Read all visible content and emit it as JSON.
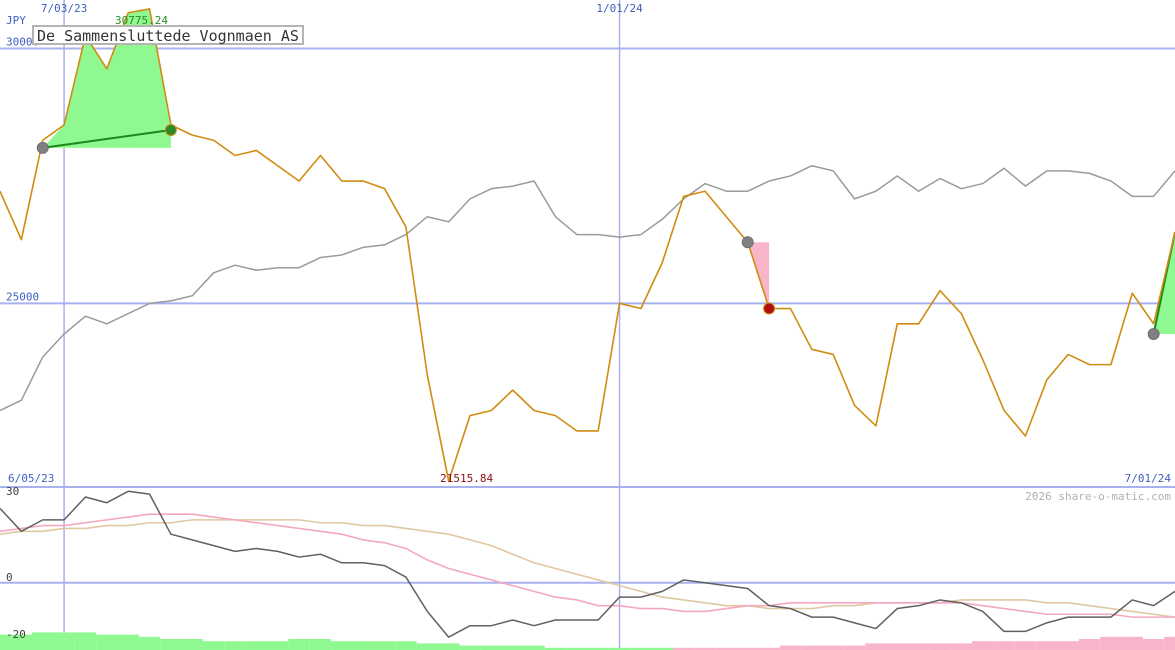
{
  "title": "De Sammensluttede Vognmaen AS",
  "watermark": "2026 share-o-matic.com",
  "colors": {
    "price": "#d08c10",
    "avg": "#9a9a9a",
    "grid": "#a8b2ee",
    "axis_text": "#4060c0",
    "gain_fill": "#90f890",
    "gain_line": "#1a8a1a",
    "loss_fill": "#f8b4c8",
    "loss_dot": "#b01010",
    "osc_dark": "#606060",
    "osc_pink": "#f4a8c0",
    "osc_tan": "#e0c8a0",
    "vol_green": "#90f890",
    "vol_pink": "#f8b4c8"
  },
  "chart_data": [
    {
      "type": "line",
      "currency_label": "JPY",
      "date_labels": [
        {
          "label": "7/03/23",
          "index": 3
        },
        {
          "label": "1/01/24",
          "index": 29
        }
      ],
      "range_labels": {
        "start": "6/05/23",
        "end": "7/01/24"
      },
      "max_label": "30775.24",
      "min_label": "21515.84",
      "ylim": [
        21400,
        30950
      ],
      "yticks": [
        25000,
        30000
      ],
      "series": [
        {
          "key": "price",
          "values": [
            27200,
            26250,
            28200,
            28500,
            30250,
            29600,
            30700,
            30775,
            28500,
            28300,
            28200,
            27900,
            28000,
            27700,
            27400,
            27900,
            27400,
            27400,
            27250,
            26500,
            23600,
            21516,
            22800,
            22900,
            23300,
            22900,
            22800,
            22500,
            22500,
            25000,
            24900,
            25800,
            27100,
            27200,
            26700,
            26200,
            24900,
            24900,
            24100,
            24000,
            23000,
            22600,
            24600,
            24600,
            25250,
            24800,
            23900,
            22900,
            22400,
            23500,
            24000,
            23800,
            23800,
            25200,
            24600,
            26400
          ]
        },
        {
          "key": "avg",
          "values": [
            22900,
            23100,
            23950,
            24400,
            24750,
            24600,
            24800,
            25000,
            25050,
            25150,
            25600,
            25750,
            25650,
            25700,
            25700,
            25900,
            25950,
            26100,
            26150,
            26350,
            26700,
            26600,
            27050,
            27250,
            27300,
            27400,
            26700,
            26350,
            26350,
            26300,
            26350,
            26650,
            27050,
            27350,
            27200,
            27200,
            27400,
            27500,
            27700,
            27600,
            27050,
            27200,
            27500,
            27200,
            27450,
            27250,
            27350,
            27650,
            27300,
            27600,
            27600,
            27550,
            27400,
            27100,
            27100,
            27600
          ]
        }
      ],
      "annotations": [
        {
          "kind": "gain",
          "from_index": 2,
          "to_index": 8,
          "from_value": 28050,
          "to_value": 28400
        },
        {
          "kind": "loss",
          "from_index": 35,
          "to_index": 36,
          "from_value": 26200,
          "to_value": 24900
        },
        {
          "kind": "gain",
          "from_index": 54,
          "to_index": 55,
          "from_value": 24400,
          "to_value": 26400
        }
      ]
    },
    {
      "type": "line",
      "ylim": [
        -20,
        30
      ],
      "yticks": [
        30,
        0,
        -20
      ],
      "series": [
        {
          "key": "osc_dark",
          "values": [
            26,
            18,
            22,
            22,
            30,
            28,
            32,
            31,
            17,
            15,
            13,
            11,
            12,
            11,
            9,
            10,
            7,
            7,
            6,
            2,
            -10,
            -19,
            -15,
            -15,
            -13,
            -15,
            -13,
            -13,
            -13,
            -5,
            -5,
            -3,
            1,
            0,
            -1,
            -2,
            -8,
            -9,
            -12,
            -12,
            -14,
            -16,
            -9,
            -8,
            -6,
            -7,
            -10,
            -17,
            -17,
            -14,
            -12,
            -12,
            -12,
            -6,
            -8,
            -3
          ]
        },
        {
          "key": "osc_pink",
          "values": [
            18,
            19,
            20,
            20,
            21,
            22,
            23,
            24,
            24,
            24,
            23,
            22,
            21,
            20,
            19,
            18,
            17,
            15,
            14,
            12,
            8,
            5,
            3,
            1,
            -1,
            -3,
            -5,
            -6,
            -8,
            -8,
            -9,
            -9,
            -10,
            -10,
            -9,
            -8,
            -8,
            -7,
            -7,
            -7,
            -7,
            -7,
            -7,
            -7,
            -7,
            -7,
            -8,
            -9,
            -10,
            -11,
            -11,
            -11,
            -11,
            -12,
            -12,
            -12
          ]
        },
        {
          "key": "osc_tan",
          "values": [
            17,
            18,
            18,
            19,
            19,
            20,
            20,
            21,
            21,
            22,
            22,
            22,
            22,
            22,
            22,
            21,
            21,
            20,
            20,
            19,
            18,
            17,
            15,
            13,
            10,
            7,
            5,
            3,
            1,
            -1,
            -3,
            -5,
            -6,
            -7,
            -8,
            -8,
            -9,
            -9,
            -9,
            -8,
            -8,
            -7,
            -7,
            -7,
            -7,
            -6,
            -6,
            -6,
            -6,
            -7,
            -7,
            -8,
            -9,
            -10,
            -11,
            -12
          ]
        }
      ]
    },
    {
      "type": "bar",
      "series": [
        {
          "key": "volume",
          "values": [
            7,
            7,
            8,
            8,
            8,
            7,
            7,
            6,
            5,
            5,
            4,
            4,
            4,
            4,
            5,
            5,
            4,
            4,
            4,
            4,
            3,
            3,
            2,
            2,
            2,
            2,
            1,
            1,
            1,
            1,
            1,
            1,
            -1,
            -1,
            -1,
            -1,
            -1,
            -2,
            -2,
            -2,
            -2,
            -3,
            -3,
            -3,
            -3,
            -3,
            -4,
            -4,
            -4,
            -4,
            -4,
            -5,
            -6,
            -6,
            -5,
            -6
          ]
        }
      ]
    }
  ]
}
